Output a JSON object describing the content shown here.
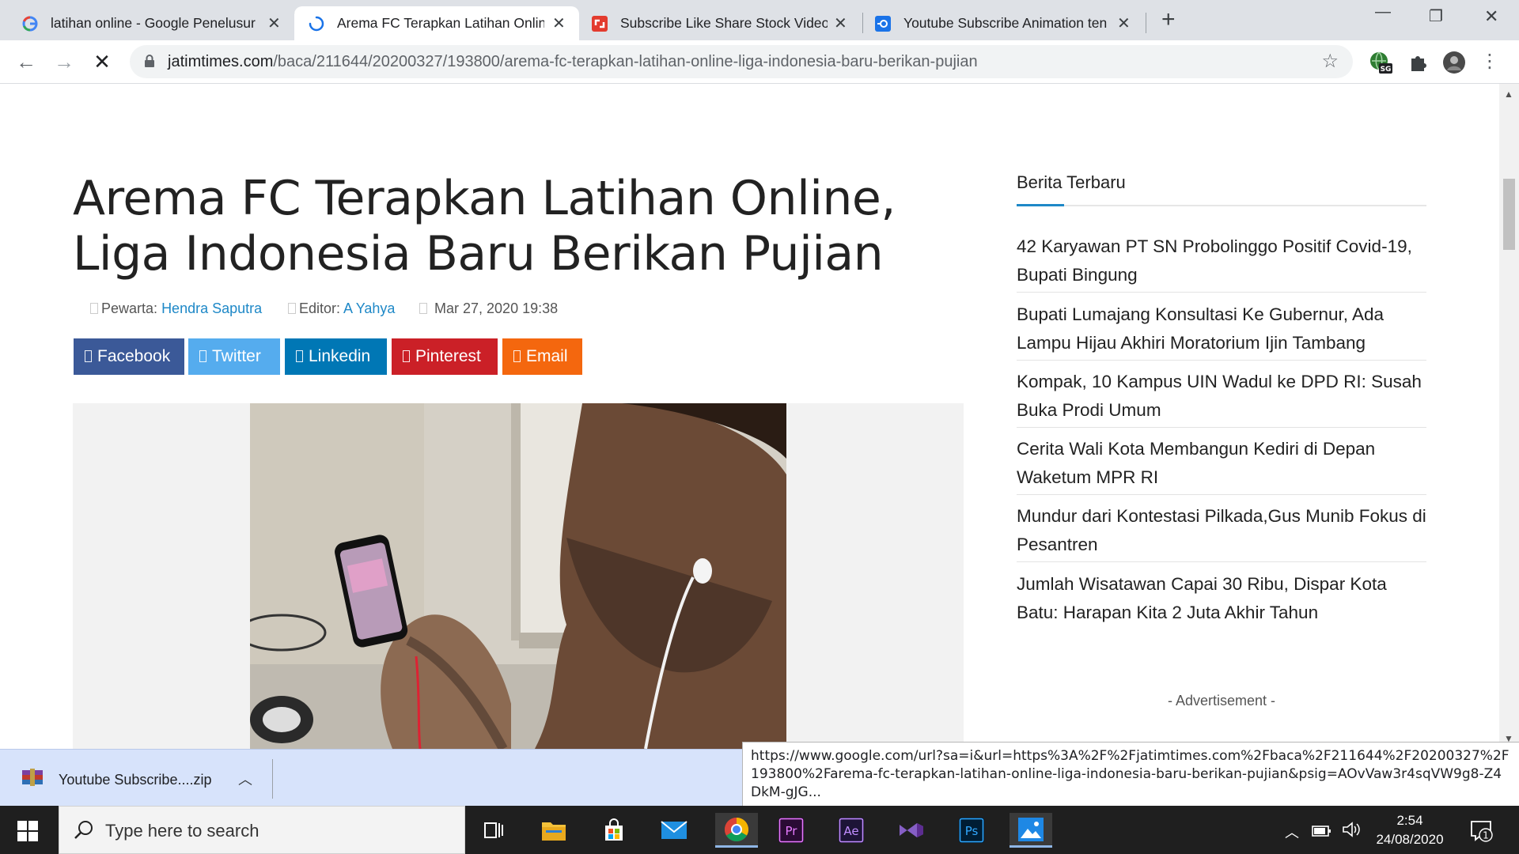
{
  "browser": {
    "tabs": [
      {
        "title": "latihan online - Google Penelusur",
        "favicon": "google-icon"
      },
      {
        "title": "Arema FC Terapkan Latihan Online",
        "favicon": "loading-spinner-icon"
      },
      {
        "title": "Subscribe Like Share Stock Video",
        "favicon": "shutterstock-icon"
      },
      {
        "title": "Youtube Subscribe Animation ten",
        "favicon": "video-app-icon"
      }
    ],
    "url_host": "jatimtimes.com",
    "url_path": "/baca/211644/20200327/193800/arema-fc-terapkan-latihan-online-liga-indonesia-baru-berikan-pujian",
    "extension_badge": "SG"
  },
  "article": {
    "headline": "Arema FC Terapkan Latihan Online, Liga Indonesia Baru Berikan Pujian",
    "author_label": "Pewarta:",
    "author": "Hendra Saputra",
    "editor_label": "Editor:",
    "editor": "A Yahya",
    "date": "Mar 27, 2020 19:38",
    "share": {
      "facebook": "Facebook",
      "twitter": "Twitter",
      "linkedin": "Linkedin",
      "pinterest": "Pinterest",
      "email": "Email"
    },
    "colors": {
      "facebook": "#3b5998",
      "twitter": "#55acee",
      "linkedin": "#0077b5",
      "pinterest": "#cb2027",
      "email": "#f4670e",
      "link": "#1e88c7"
    }
  },
  "sidebar": {
    "title": "Berita Terbaru",
    "items": [
      "42 Karyawan PT SN Probolinggo Positif Covid-19, Bupati Bingung",
      "Bupati Lumajang Konsultasi Ke Gubernur, Ada Lampu Hijau Akhiri Moratorium Ijin Tambang",
      "Kompak, 10 Kampus UIN Wadul ke DPD RI: Susah Buka Prodi Umum",
      "Cerita Wali Kota Membangun Kediri di Depan Waketum MPR RI",
      "Mundur dari Kontestasi Pilkada,Gus Munib Fokus di Pesantren",
      "Jumlah Wisatawan Capai 30 Ribu, Dispar Kota Batu: Harapan Kita 2 Juta Akhir Tahun"
    ],
    "advertisement": "- Advertisement -"
  },
  "downloads": {
    "file": "Youtube Subscribe....zip"
  },
  "status_url": "https://www.google.com/url?sa=i&url=https%3A%2F%2Fjatimtimes.com%2Fbaca%2F211644%2F20200327%2F193800%2Farema-fc-terapkan-latihan-online-liga-indonesia-baru-berikan-pujian&psig=AOvVaw3r4sqVW9g8-Z4DkM-gJG...",
  "taskbar": {
    "search_placeholder": "Type here to search",
    "time": "2:54",
    "date": "24/08/2020",
    "notifications": "1",
    "apps": [
      "task-view-icon",
      "file-explorer-icon",
      "store-icon",
      "mail-icon",
      "chrome-icon",
      "premiere-pro-icon",
      "after-effects-icon",
      "visual-studio-icon",
      "photoshop-icon",
      "photos-icon"
    ]
  }
}
